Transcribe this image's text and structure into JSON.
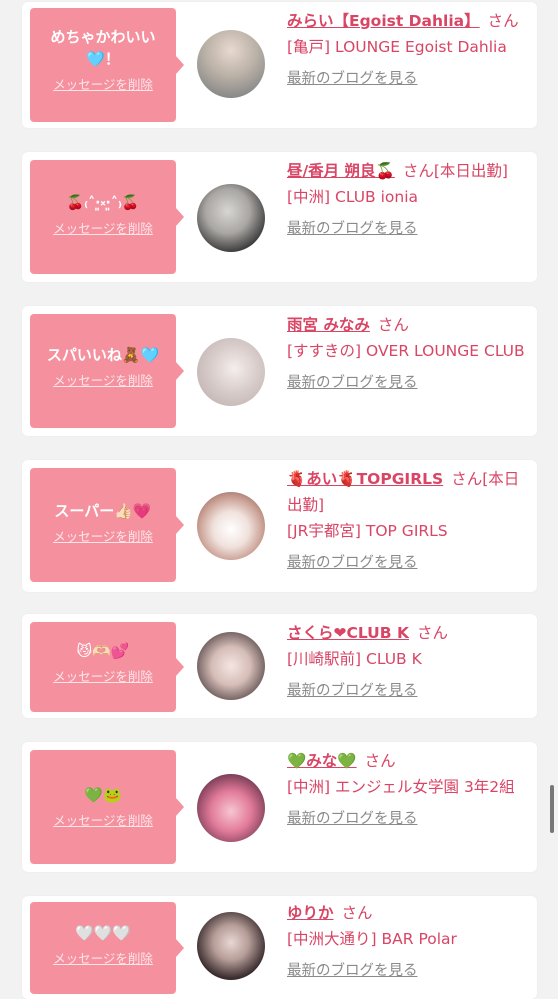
{
  "entries": [
    {
      "message": "めちゃかわいい🩵！",
      "delete_label": "メッセージを削除",
      "name": "みらい【Egoist Dahlia】",
      "suffix": "さん",
      "shop": "[亀戸] LOUNGE Egoist Dahlia",
      "blog_label": "最新のブログを見る"
    },
    {
      "message": "🍒₍˄·͈༝·͈˄₎🍒",
      "delete_label": "メッセージを削除",
      "name": "昼/香月 朔良🍒",
      "suffix": "さん[本日出勤]",
      "shop": "[中洲] CLUB ionia",
      "blog_label": "最新のブログを見る"
    },
    {
      "message": "スパいいね🧸🩵",
      "delete_label": "メッセージを削除",
      "name": "雨宮 みなみ",
      "suffix": "さん",
      "shop": "[すすきの] OVER LOUNGE CLUB",
      "blog_label": "最新のブログを見る"
    },
    {
      "message": "スーパー👍🏻💗",
      "delete_label": "メッセージを削除",
      "name": "🫀あい🫀TOPGIRLS",
      "suffix": "さん[本日出勤]",
      "shop": "[JR宇都宮] TOP GIRLS",
      "blog_label": "最新のブログを見る"
    },
    {
      "message": "😼🫶🏻💕",
      "delete_label": "メッセージを削除",
      "name": "さくら❤CLUB K",
      "suffix": "さん",
      "shop": "[川崎駅前] CLUB K",
      "blog_label": "最新のブログを見る"
    },
    {
      "message": "💚🐸",
      "delete_label": "メッセージを削除",
      "name": "💚みな💚",
      "suffix": "さん",
      "shop": "[中洲] エンジェル女学園 3年2組",
      "blog_label": "最新のブログを見る"
    },
    {
      "message": "🤍🤍🤍",
      "delete_label": "メッセージを削除",
      "name": "ゆりか",
      "suffix": "さん",
      "shop": "[中洲大通り] BAR Polar",
      "blog_label": "最新のブログを見る"
    }
  ],
  "colors": {
    "accent": "#d94565",
    "bubble": "#f5919f",
    "link_gray": "#8a8a8a"
  }
}
